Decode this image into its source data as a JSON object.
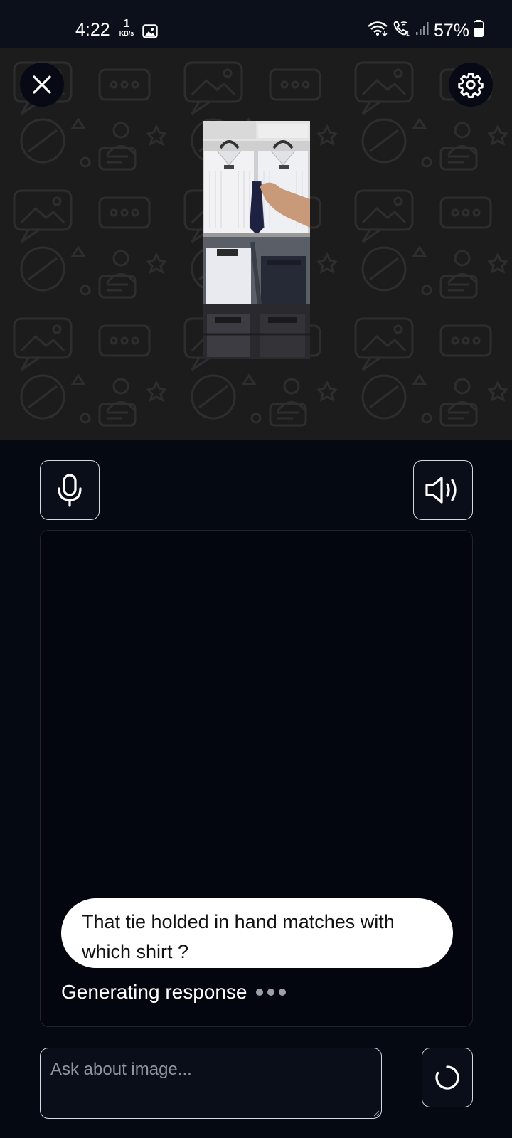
{
  "status_bar": {
    "time": "4:22",
    "net_speed_value": "1",
    "net_speed_unit": "KB/s",
    "battery": "57%",
    "icons": [
      "gallery-icon",
      "wifi-icon",
      "wifi-calling-icon",
      "signal-icon",
      "battery-icon"
    ]
  },
  "header": {
    "close_icon": "close-icon",
    "settings_icon": "gear-icon"
  },
  "image_preview": {
    "alt": "Photo of shirts on a rack with a hand holding a navy tie"
  },
  "controls": {
    "mic_icon": "microphone-icon",
    "speaker_icon": "speaker-icon"
  },
  "chat": {
    "user_message": "That tie holded in hand matches with which shirt ?",
    "status_text": "Generating response"
  },
  "input": {
    "placeholder": "Ask about image...",
    "value": ""
  },
  "send_button": {
    "icon": "loading-spinner-icon"
  },
  "colors": {
    "background": "#050912",
    "status_bar": "#0c101a",
    "hero": "#1c1c1c",
    "border": "#d6d9e0",
    "bubble": "#ffffff",
    "muted": "#8f95a1"
  }
}
